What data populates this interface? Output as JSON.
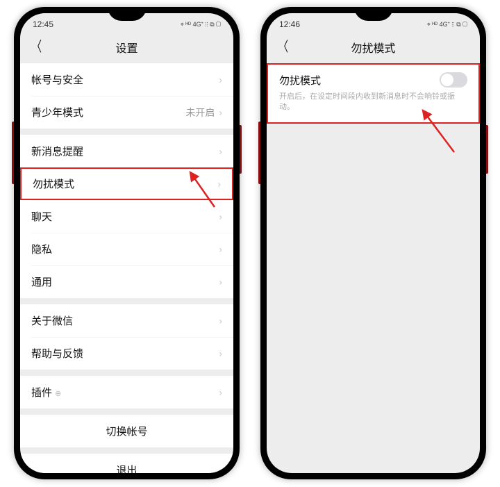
{
  "phone1": {
    "status": {
      "time": "12:45",
      "icons_text": "⌖ ᴴᴰ 4G⁺ ⫶⫶ ⧉ ▢"
    },
    "header": {
      "title": "设置"
    },
    "groups": [
      [
        {
          "label": "帐号与安全",
          "value": "",
          "highlight": false
        },
        {
          "label": "青少年模式",
          "value": "未开启",
          "highlight": false
        }
      ],
      [
        {
          "label": "新消息提醒",
          "value": "",
          "highlight": false
        },
        {
          "label": "勿扰模式",
          "value": "",
          "highlight": true
        },
        {
          "label": "聊天",
          "value": "",
          "highlight": false
        },
        {
          "label": "隐私",
          "value": "",
          "highlight": false
        },
        {
          "label": "通用",
          "value": "",
          "highlight": false
        }
      ],
      [
        {
          "label": "关于微信",
          "value": "",
          "highlight": false
        },
        {
          "label": "帮助与反馈",
          "value": "",
          "highlight": false
        }
      ],
      [
        {
          "label": "插件",
          "value": "",
          "highlight": false,
          "has_plugin_icon": true
        }
      ]
    ],
    "actions": {
      "switch_account": "切换帐号",
      "logout": "退出"
    }
  },
  "phone2": {
    "status": {
      "time": "12:46",
      "icons_text": "⌖ ᴴᴰ 4G⁺ ⫶⫶ ⧉ ▢"
    },
    "header": {
      "title": "勿扰模式"
    },
    "item": {
      "label": "勿扰模式",
      "desc": "开启后，在设定时间段内收到新消息时不会响铃或振动。",
      "toggle_on": false
    }
  }
}
